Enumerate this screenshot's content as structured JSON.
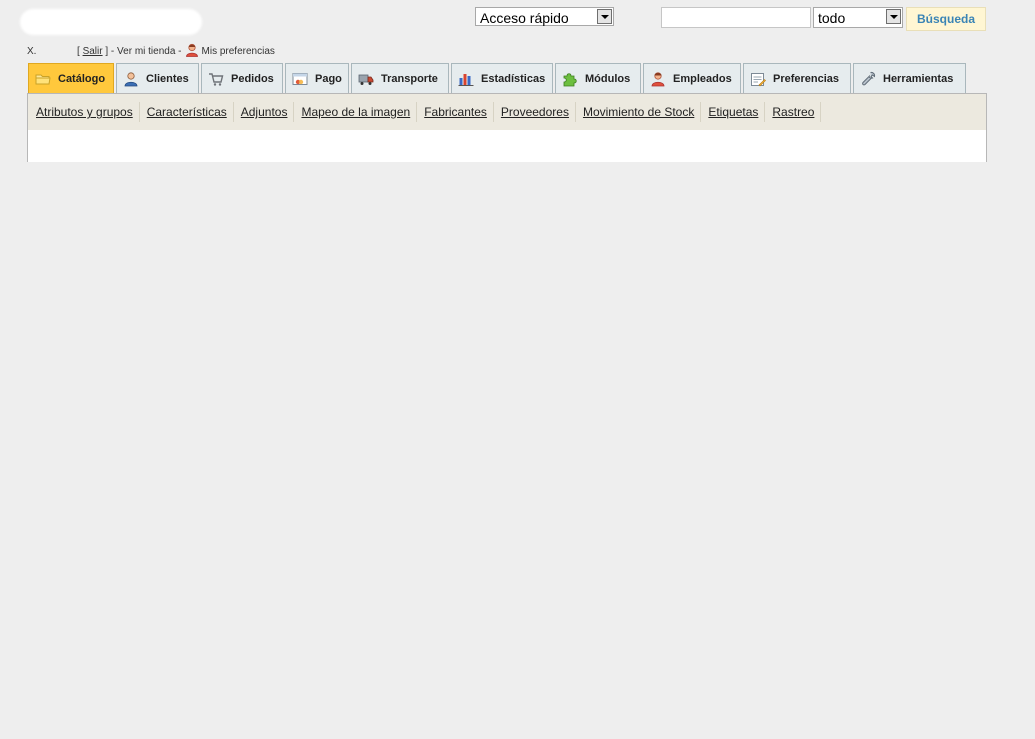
{
  "header": {
    "quick_access": "Acceso rápido",
    "search_value": "",
    "search_scope": "todo",
    "search_button": "Búsqueda"
  },
  "user_bar": {
    "initial": "X.",
    "logout_open": "[",
    "logout": "Salir",
    "logout_close": "] -",
    "view_store": "Ver mi tienda -",
    "preferences": "Mis preferencias"
  },
  "tabs": [
    {
      "label": "Catálogo",
      "icon": "folder-icon",
      "active": true
    },
    {
      "label": "Clientes",
      "icon": "customer-icon",
      "active": false
    },
    {
      "label": "Pedidos",
      "icon": "cart-icon",
      "active": false
    },
    {
      "label": "Pago",
      "icon": "payment-icon",
      "active": false
    },
    {
      "label": "Transporte",
      "icon": "truck-icon",
      "active": false
    },
    {
      "label": "Estadísticas",
      "icon": "chart-icon",
      "active": false
    },
    {
      "label": "Módulos",
      "icon": "puzzle-icon",
      "active": false
    },
    {
      "label": "Empleados",
      "icon": "employee-icon",
      "active": false
    },
    {
      "label": "Preferencias",
      "icon": "preferences-icon",
      "active": false
    },
    {
      "label": "Herramientas",
      "icon": "wrench-icon",
      "active": false
    }
  ],
  "subnav": [
    "Atributos y grupos",
    "Características",
    "Adjuntos",
    "Mapeo de la imagen",
    "Fabricantes",
    "Proveedores",
    "Movimiento de Stock",
    "Etiquetas",
    "Rastreo"
  ],
  "colors": {
    "active_tab": "#ffc83c",
    "tab_bg": "#e6ecee",
    "search_button_text": "#3a84b5",
    "page_bg": "#eeeeee"
  }
}
